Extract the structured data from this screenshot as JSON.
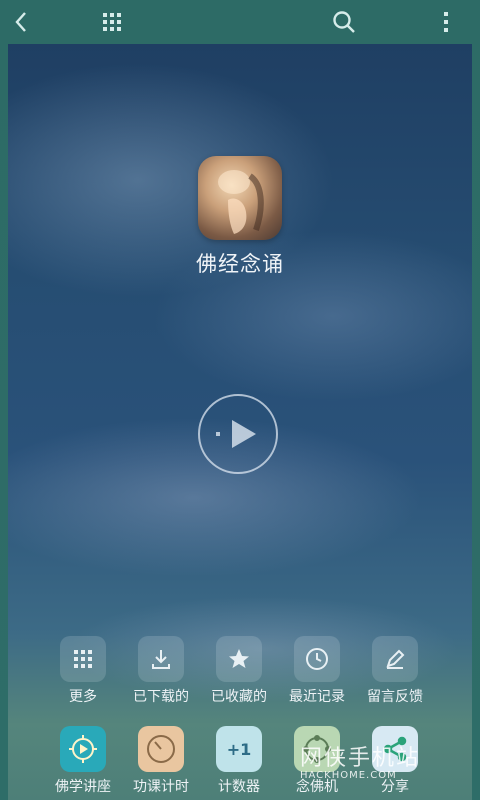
{
  "app": {
    "name": "佛经念诵"
  },
  "toolbar": {
    "back_icon": "back-arrow-icon",
    "grid_icon": "grid-icon",
    "search_icon": "search-icon",
    "more_icon": "more-vertical-icon"
  },
  "player": {
    "play_icon": "play-icon"
  },
  "actions_row1": [
    {
      "label": "更多",
      "icon": "grid-icon"
    },
    {
      "label": "已下载的",
      "icon": "download-icon"
    },
    {
      "label": "已收藏的",
      "icon": "star-icon"
    },
    {
      "label": "最近记录",
      "icon": "clock-icon"
    },
    {
      "label": "留言反馈",
      "icon": "pencil-icon"
    }
  ],
  "actions_row2": [
    {
      "label": "佛学讲座",
      "icon": "dharma-play-icon"
    },
    {
      "label": "功课计时",
      "icon": "timer-icon"
    },
    {
      "label": "计数器",
      "icon": "counter-icon",
      "tile_text": "+1"
    },
    {
      "label": "念佛机",
      "icon": "prayer-beads-icon"
    },
    {
      "label": "分享",
      "icon": "share-icon"
    }
  ],
  "watermark": {
    "text": "网侠手机站",
    "url": "HACKHOME.COM"
  }
}
